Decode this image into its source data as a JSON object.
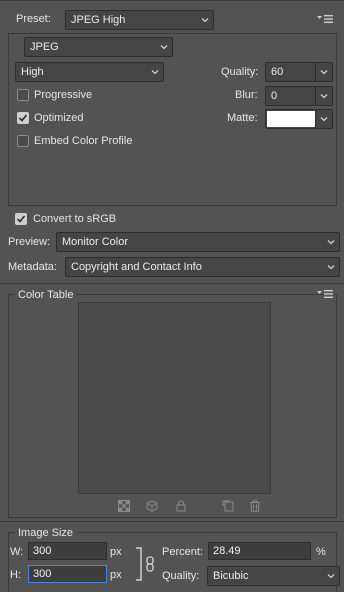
{
  "preset": {
    "label": "Preset:",
    "value": "JPEG High",
    "menu_icon": "panel-menu-icon"
  },
  "format": {
    "value": "JPEG"
  },
  "quality_preset": {
    "value": "High"
  },
  "quality": {
    "label": "Quality:",
    "value": "60"
  },
  "blur": {
    "label": "Blur:",
    "value": "0"
  },
  "matte": {
    "label": "Matte:",
    "color": "#ffffff"
  },
  "options": {
    "progressive": {
      "label": "Progressive",
      "checked": false
    },
    "optimized": {
      "label": "Optimized",
      "checked": true
    },
    "embed_profile": {
      "label": "Embed Color Profile",
      "checked": false
    }
  },
  "convert_srgb": {
    "label": "Convert to sRGB",
    "checked": true
  },
  "preview": {
    "label": "Preview:",
    "value": "Monitor Color"
  },
  "metadata": {
    "label": "Metadata:",
    "value": "Copyright and Contact Info"
  },
  "color_table": {
    "title": "Color Table",
    "toolbar": [
      "map-transparent-icon",
      "web-snap-icon",
      "lock-color-icon",
      "new-color-icon",
      "trash-icon"
    ]
  },
  "image_size": {
    "title": "Image Size",
    "w_label": "W:",
    "w_value": "300",
    "h_label": "H:",
    "h_value": "300",
    "unit": "px",
    "percent_label": "Percent:",
    "percent_value": "28.49",
    "percent_unit": "%",
    "quality_label": "Quality:",
    "quality_value": "Bicubic"
  },
  "colors": {
    "background": "#535353",
    "field": "#454545",
    "border": "#2d2d2d",
    "text": "#e6e6e6",
    "focus": "#4a86d6"
  }
}
